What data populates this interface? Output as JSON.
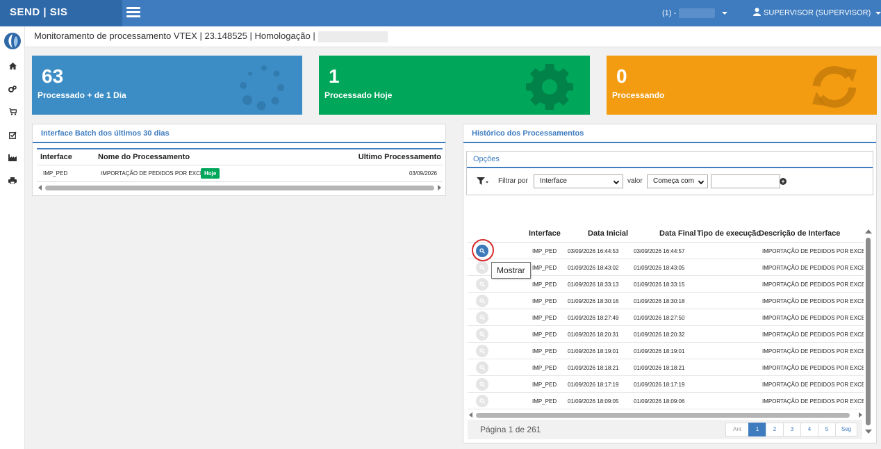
{
  "brand": {
    "name": "SEND | SIS"
  },
  "header": {
    "environment_label": "(1) -",
    "user_label": "SUPERVISOR (SUPERVISOR)"
  },
  "page": {
    "title": "Monitoramento de processamento VTEX | 23.148525 | Homologação |"
  },
  "sidebar": {
    "icons": [
      "home-icon",
      "cogs-icon",
      "cart-icon",
      "check-square-icon",
      "industry-icon",
      "print-icon"
    ]
  },
  "stats": [
    {
      "value": "63",
      "label": "Processado + de 1 Dia",
      "color": "#3c8dc5",
      "icon": "spinner-icon"
    },
    {
      "value": "1",
      "label": "Processado Hoje",
      "color": "#00a65a",
      "icon": "gear-icon"
    },
    {
      "value": "0",
      "label": "Processando",
      "color": "#f39c12",
      "icon": "refresh-icon"
    }
  ],
  "batch_panel": {
    "title": "Interface Batch dos últimos 30 dias",
    "columns": [
      "Interface",
      "Nome do Processamento",
      "Ultimo Processamento"
    ],
    "rows": [
      {
        "interface": "IMP_PED",
        "name": "IMPORTAÇÃO DE PEDIDOS POR EXCEL",
        "badge": "Hoje",
        "last": "03/09/2026"
      }
    ]
  },
  "history_panel": {
    "title": "Histórico dos Processamentos",
    "options_title": "Opções",
    "filter_label": "Filtrar por",
    "filter_field": "Interface",
    "value_label": "valor",
    "match_mode": "Começa com",
    "filter_value": "",
    "columns": [
      "Interface",
      "Data Inicial",
      "Data Final",
      "Tipo de execução",
      "Descrição de Interface"
    ],
    "rows": [
      {
        "interface": "IMP_PED",
        "start": "03/09/2026 16:44:53",
        "end": "03/09/2026 16:44:57",
        "type": "",
        "desc": "IMPORTAÇÃO DE PEDIDOS POR EXCEL"
      },
      {
        "interface": "IMP_PED",
        "start": "01/09/2026 18:43:02",
        "end": "01/09/2026 18:43:05",
        "type": "",
        "desc": "IMPORTAÇÃO DE PEDIDOS POR EXCEL"
      },
      {
        "interface": "IMP_PED",
        "start": "01/09/2026 18:33:13",
        "end": "01/09/2026 18:33:15",
        "type": "",
        "desc": "IMPORTAÇÃO DE PEDIDOS POR EXCEL"
      },
      {
        "interface": "IMP_PED",
        "start": "01/09/2026 18:30:16",
        "end": "01/09/2026 18:30:18",
        "type": "",
        "desc": "IMPORTAÇÃO DE PEDIDOS POR EXCEL"
      },
      {
        "interface": "IMP_PED",
        "start": "01/09/2026 18:27:49",
        "end": "01/09/2026 18:27:50",
        "type": "",
        "desc": "IMPORTAÇÃO DE PEDIDOS POR EXCEL"
      },
      {
        "interface": "IMP_PED",
        "start": "01/09/2026 18:20:31",
        "end": "01/09/2026 18:20:32",
        "type": "",
        "desc": "IMPORTAÇÃO DE PEDIDOS POR EXCEL"
      },
      {
        "interface": "IMP_PED",
        "start": "01/09/2026 18:19:01",
        "end": "01/09/2026 18:19:01",
        "type": "",
        "desc": "IMPORTAÇÃO DE PEDIDOS POR EXCEL"
      },
      {
        "interface": "IMP_PED",
        "start": "01/09/2026 18:18:21",
        "end": "01/09/2026 18:18:21",
        "type": "",
        "desc": "IMPORTAÇÃO DE PEDIDOS POR EXCEL"
      },
      {
        "interface": "IMP_PED",
        "start": "01/09/2026 18:17:19",
        "end": "01/09/2026 18:17:19",
        "type": "",
        "desc": "IMPORTAÇÃO DE PEDIDOS POR EXCEL"
      },
      {
        "interface": "IMP_PED",
        "start": "01/09/2026 18:09:05",
        "end": "01/09/2026 18:09:06",
        "type": "",
        "desc": "IMPORTAÇÃO DE PEDIDOS POR EXCEL"
      }
    ],
    "tooltip": "Mostrar",
    "page_info": "Página 1 de 261",
    "pagination": {
      "prev": "Ant",
      "pages": [
        "1",
        "2",
        "3",
        "4",
        "5"
      ],
      "active_page": "1",
      "next": "Seg"
    }
  }
}
